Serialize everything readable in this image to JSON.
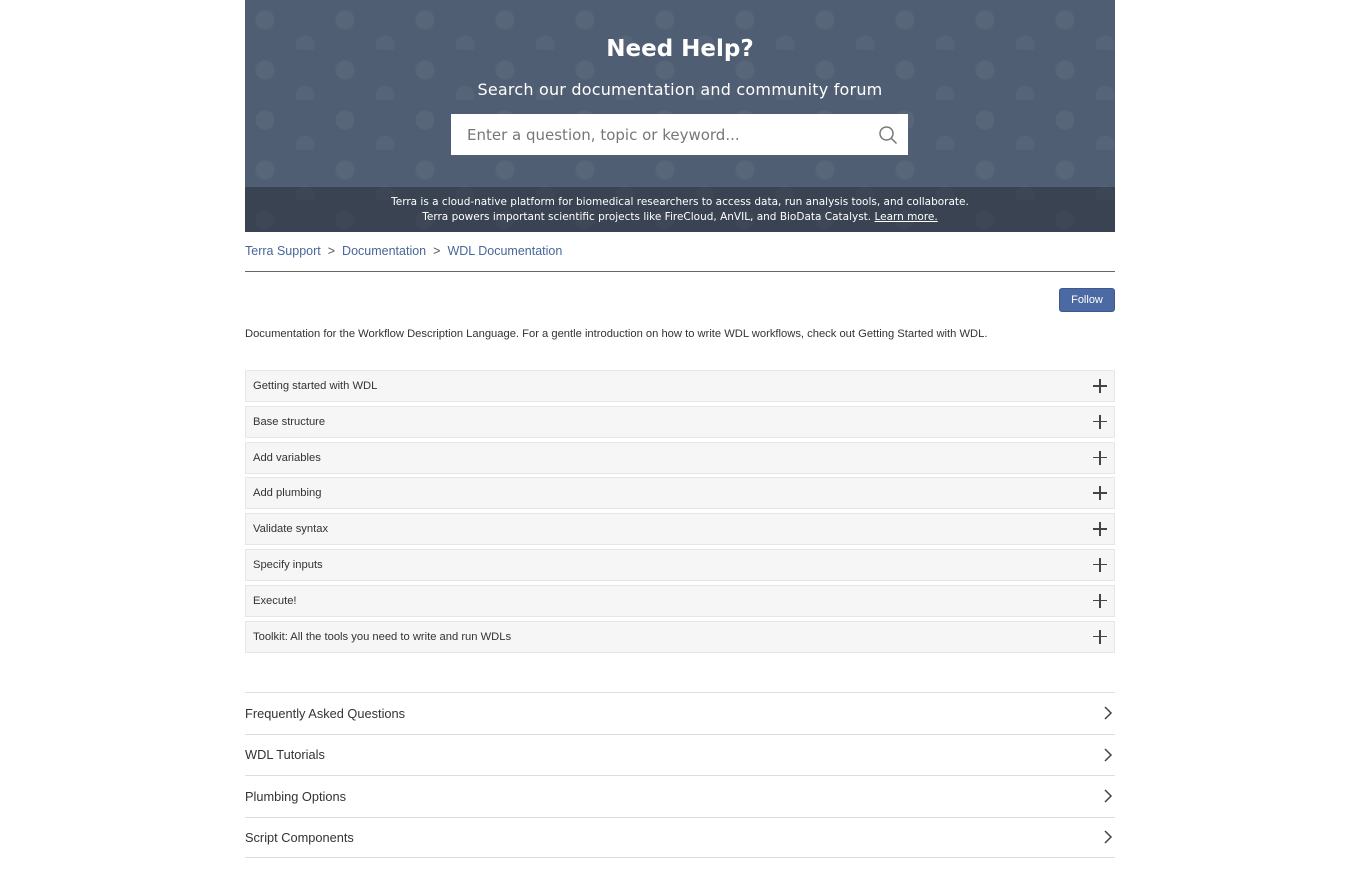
{
  "hero": {
    "title": "Need Help?",
    "subtitle": "Search our documentation and community forum",
    "search_placeholder": "Enter a question, topic or keyword...",
    "band_line1": "Terra is a cloud-native platform for biomedical researchers to access data, run analysis tools, and collaborate.",
    "band_line2": "Terra powers important scientific projects like FireCloud, AnVIL, and BioData Catalyst.",
    "band_link": "Learn more."
  },
  "breadcrumb": {
    "items": [
      "Terra Support",
      "Documentation",
      "WDL Documentation"
    ],
    "separator": ">"
  },
  "follow_label": "Follow",
  "description": "Documentation for the Workflow Description Language. For a gentle introduction on how to write WDL workflows, check out Getting Started with WDL.",
  "accordion": [
    {
      "label": "Getting started with WDL"
    },
    {
      "label": "Base structure"
    },
    {
      "label": "Add variables"
    },
    {
      "label": "Add plumbing"
    },
    {
      "label": "Validate syntax"
    },
    {
      "label": "Specify inputs"
    },
    {
      "label": "Execute!"
    },
    {
      "label": "Toolkit: All the tools you need to write and run WDLs"
    }
  ],
  "sections": [
    {
      "label": "Frequently Asked Questions"
    },
    {
      "label": "WDL Tutorials"
    },
    {
      "label": "Plumbing Options"
    },
    {
      "label": "Script Components"
    }
  ],
  "icons": {
    "search": "search-icon",
    "expand": "plus-icon",
    "navigate": "chevron-right-icon"
  },
  "colors": {
    "hero_bg": "#4f5e72",
    "link": "#48669a",
    "button": "#4b6aa3"
  }
}
